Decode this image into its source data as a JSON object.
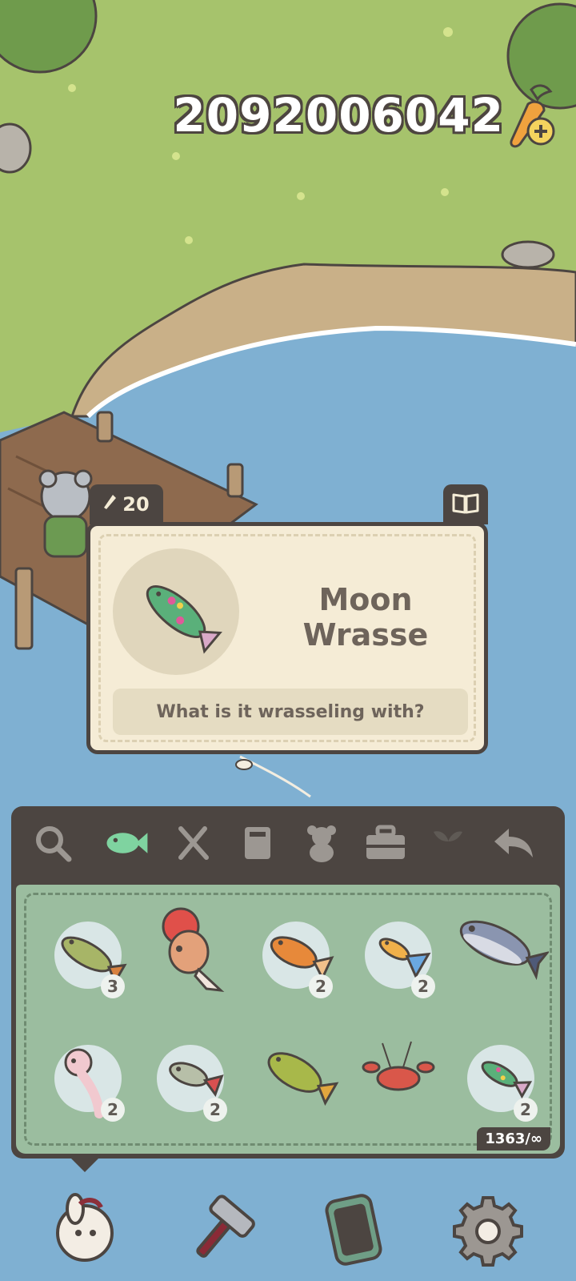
{
  "hud": {
    "currency": "2092006042",
    "currency_icon": "carrot-plus-icon"
  },
  "tooltip": {
    "price": "20",
    "price_icon": "carrot-icon",
    "book_icon": "open-book-icon",
    "fish_name": "Moon Wrasse",
    "fish_description": "What is it wrasseling with?"
  },
  "inventory": {
    "tabs": [
      {
        "icon": "search-icon"
      },
      {
        "icon": "fish-icon",
        "active": true
      },
      {
        "icon": "fork-knife-icon"
      },
      {
        "icon": "book-icon"
      },
      {
        "icon": "teddy-bear-icon"
      },
      {
        "icon": "toolbox-icon"
      },
      {
        "icon": "sprout-icon"
      },
      {
        "icon": "back-arrow-icon"
      }
    ],
    "items": [
      {
        "icon": "perch-fish-icon",
        "count": "3"
      },
      {
        "icon": "red-goldfish-icon",
        "count": ""
      },
      {
        "icon": "orange-carp-icon",
        "count": "2"
      },
      {
        "icon": "guppy-icon",
        "count": "2"
      },
      {
        "icon": "tuna-icon",
        "count": ""
      },
      {
        "icon": "axolotl-icon",
        "count": "2"
      },
      {
        "icon": "tetra-fish-icon",
        "count": "2"
      },
      {
        "icon": "bass-fish-icon",
        "count": ""
      },
      {
        "icon": "crayfish-icon",
        "count": ""
      },
      {
        "icon": "moon-wrasse-icon",
        "count": "2"
      }
    ],
    "capacity": "1363/∞"
  },
  "bottom_bar": [
    {
      "icon": "bunny-character-icon"
    },
    {
      "icon": "hammer-icon"
    },
    {
      "icon": "phone-icon"
    },
    {
      "icon": "gear-icon"
    }
  ]
}
